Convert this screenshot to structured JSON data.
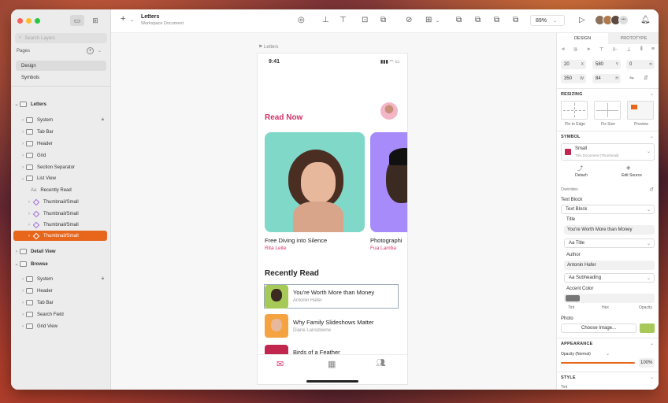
{
  "document": {
    "title": "Letters",
    "subtitle": "Workspace Document",
    "zoom": "89%"
  },
  "left_panel": {
    "search_placeholder": "Search Layers",
    "pages_label": "Pages",
    "pages": [
      "Design",
      "Symbols"
    ],
    "letters_group": "Letters",
    "letters_layers": [
      "System",
      "Tab Bar",
      "Header",
      "Grid",
      "Section Separator",
      "List View"
    ],
    "list_view_children": [
      "Recently Read",
      "Thumbnail/Small",
      "Thumbnail/Small",
      "Thumbnail/Small",
      "Thumbnail/Small"
    ],
    "detail_view": "Detail View",
    "browse_group": "Browse",
    "browse_layers": [
      "System",
      "Header",
      "Tab Bar",
      "Search Field",
      "Grid View"
    ]
  },
  "canvas": {
    "artboard_label": "Letters",
    "status_time": "9:41",
    "read_now_title": "Read Now",
    "cards": [
      {
        "title": "Free Diving into Silence",
        "author": "Rita Leite"
      },
      {
        "title": "Photographi",
        "author": "Fua Lamba"
      }
    ],
    "recently_read_title": "Recently Read",
    "recently_read": [
      {
        "title": "You're Worth More than Money",
        "author": "Antonin Hafer"
      },
      {
        "title": "Why Family Slideshows Matter",
        "author": "Diane Lansdowne"
      },
      {
        "title": "Birds of a Feather",
        "author": ""
      }
    ]
  },
  "inspector": {
    "tabs": [
      "DESIGN",
      "PROTOTYPE"
    ],
    "x": "20",
    "y": "580",
    "rotation": "0",
    "width": "350",
    "height": "84",
    "resizing_label": "RESIZING",
    "resizing_options": [
      "Pin to Edge",
      "Fix Size",
      "Preview"
    ],
    "symbol_label": "SYMBOL",
    "symbol_name": "Small",
    "symbol_source": "This Document (Thumbnail)",
    "detach": "Detach",
    "edit_source": "Edit Source",
    "overrides_label": "Overrides",
    "text_block_label": "Text Block",
    "text_block_value": "Text Block",
    "title_label": "Title",
    "title_value": "You're Worth More than Money",
    "title_style": "Aa Title",
    "author_label": "Author",
    "author_value": "Antonin Hafer",
    "author_style": "Aa Subheading",
    "accent_label": "Accent Color",
    "accent_sub": [
      "Tint",
      "Hex",
      "Opacity"
    ],
    "photo_label": "Photo",
    "choose_image": "Choose Image...",
    "appearance_label": "APPEARANCE",
    "opacity_label": "Opacity (Normal)",
    "opacity_value": "100%",
    "style_label": "STYLE",
    "tint_label": "Tint"
  },
  "colors": {
    "accent": "#e8651c",
    "pink": "#d6336c",
    "teal": "#7fd8c8",
    "purple": "#a78bfa"
  }
}
